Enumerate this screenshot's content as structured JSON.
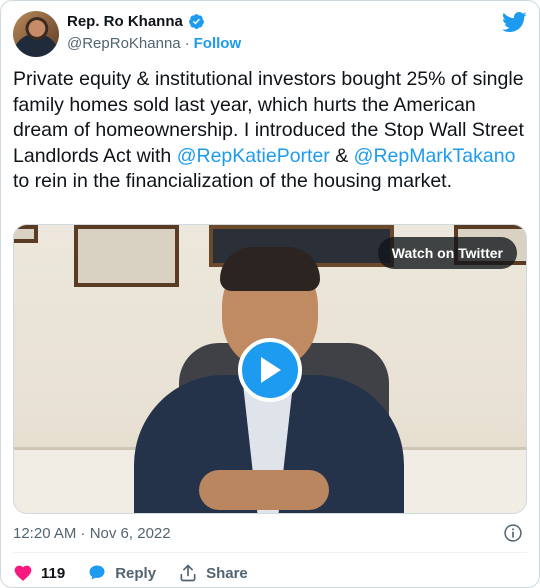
{
  "author": {
    "name": "Rep. Ro Khanna",
    "handle": "@RepRoKhanna",
    "separator": "·",
    "follow_label": "Follow"
  },
  "tweet": {
    "text_segments": [
      {
        "text": "Private equity & institutional investors bought 25% of single family homes sold last year, which hurts the American dream of homeownership. I introduced the Stop Wall Street Landlords Act with ",
        "type": "text"
      },
      {
        "text": "@RepKatiePorter",
        "type": "mention"
      },
      {
        "text": " & ",
        "type": "text"
      },
      {
        "text": "@RepMarkTakano",
        "type": "mention"
      },
      {
        "text": " to rein in the financialization of the housing market.",
        "type": "text"
      }
    ]
  },
  "media": {
    "watch_label": "Watch on Twitter"
  },
  "meta": {
    "timestamp": "12:20 AM · Nov 6, 2022"
  },
  "actions": {
    "like_count": "119",
    "reply_label": "Reply",
    "share_label": "Share"
  },
  "colors": {
    "accent": "#1d9bf0",
    "like": "#f91880",
    "muted": "#536471"
  }
}
